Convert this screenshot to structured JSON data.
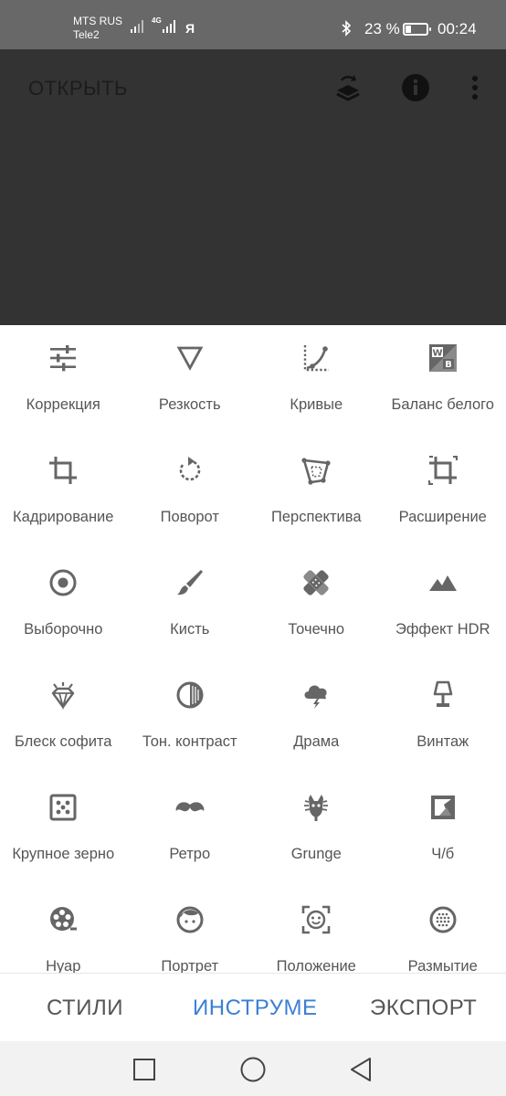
{
  "status": {
    "carrier1": "MTS RUS",
    "carrier2": "Tele2",
    "net_type": "4G",
    "ya": "Я",
    "battery_pct": "23 %",
    "battery_level": 0.23,
    "time": "00:24"
  },
  "toolbar": {
    "open_label": "ОТКРЫТЬ",
    "icons": [
      "layers-undo-icon",
      "info-icon",
      "more-vert-icon"
    ]
  },
  "tools": [
    {
      "label": "Коррекция",
      "icon": "tune-icon"
    },
    {
      "label": "Резкость",
      "icon": "sharpness-triangle-icon"
    },
    {
      "label": "Кривые",
      "icon": "curves-icon"
    },
    {
      "label": "Баланс белого",
      "icon": "white-balance-icon"
    },
    {
      "label": "Кадрирование",
      "icon": "crop-icon"
    },
    {
      "label": "Поворот",
      "icon": "rotate-icon"
    },
    {
      "label": "Перспектива",
      "icon": "perspective-icon"
    },
    {
      "label": "Расширение",
      "icon": "expand-icon"
    },
    {
      "label": "Выборочно",
      "icon": "selective-icon"
    },
    {
      "label": "Кисть",
      "icon": "brush-icon"
    },
    {
      "label": "Точечно",
      "icon": "healing-icon"
    },
    {
      "label": "Эффект HDR",
      "icon": "hdr-mountains-icon"
    },
    {
      "label": "Блеск софита",
      "icon": "glamour-glow-icon"
    },
    {
      "label": "Тон. контраст",
      "icon": "tonal-contrast-icon"
    },
    {
      "label": "Драма",
      "icon": "drama-cloud-icon"
    },
    {
      "label": "Винтаж",
      "icon": "vintage-lamp-icon"
    },
    {
      "label": "Крупное зерно",
      "icon": "grainy-film-icon"
    },
    {
      "label": "Ретро",
      "icon": "retro-mustache-icon"
    },
    {
      "label": "Grunge",
      "icon": "grunge-guitar-icon"
    },
    {
      "label": "Ч/б",
      "icon": "black-white-icon"
    },
    {
      "label": "Нуар",
      "icon": "noir-film-reel-icon"
    },
    {
      "label": "Портрет",
      "icon": "portrait-face-icon"
    },
    {
      "label": "Положение",
      "icon": "head-pose-icon"
    },
    {
      "label": "Размытие",
      "icon": "lens-blur-icon"
    }
  ],
  "tabs": {
    "styles": "СТИЛИ",
    "tools": "ИНСТРУМЕ",
    "export": "ЭКСПОРТ"
  },
  "colors": {
    "accent": "#3a7fd5",
    "icon": "#666666",
    "canvas": "#333333",
    "statusbar": "#686868"
  }
}
